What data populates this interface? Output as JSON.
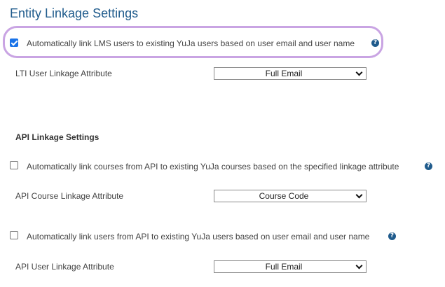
{
  "page": {
    "title": "Entity Linkage Settings"
  },
  "lms": {
    "auto_link_label": "Automatically link LMS users to existing YuJa users based on user email and user name",
    "auto_link_checked": true,
    "lti_attr_label": "LTI User Linkage Attribute",
    "lti_attr_value": "Full Email"
  },
  "api": {
    "section_title": "API Linkage Settings",
    "courses_label": "Automatically link courses from API to existing YuJa courses based on the specified linkage attribute",
    "courses_checked": false,
    "course_attr_label": "API Course Linkage Attribute",
    "course_attr_value": "Course Code",
    "users_label": "Automatically link users from API to existing YuJa users based on user email and user name",
    "users_checked": false,
    "user_attr_label": "API User Linkage Attribute",
    "user_attr_value": "Full Email"
  },
  "icons": {
    "help": "question-circle-icon",
    "help_glyph": "?",
    "dropdown": "chevron-down-icon"
  },
  "colors": {
    "title": "#1f5b8c",
    "highlight": "#c9a4e3",
    "checkbox_checked": "#1a73e8",
    "help_icon": "#1f5b8c"
  }
}
